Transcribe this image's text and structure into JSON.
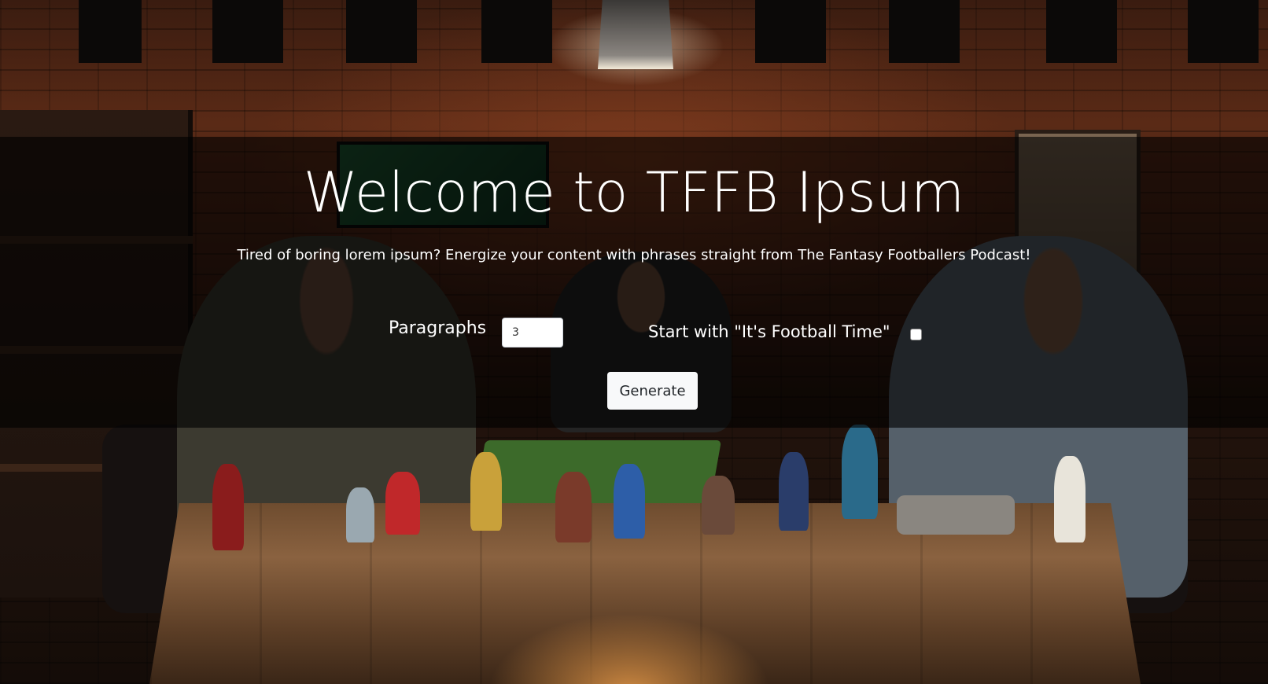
{
  "hero": {
    "title": "Welcome to TFFB Ipsum",
    "subtitle": "Tired of boring lorem ipsum? Energize your content with phrases straight from The Fantasy Footballers Podcast!"
  },
  "form": {
    "paragraphs_label": "Paragraphs",
    "paragraphs_value": "3",
    "start_label": "Start with \"It's Football Time\"",
    "start_checked": false,
    "generate_label": "Generate"
  },
  "colors": {
    "overlay": "#000000",
    "text": "#ffffff",
    "button_bg": "#f8f9fa",
    "button_text": "#212529"
  }
}
